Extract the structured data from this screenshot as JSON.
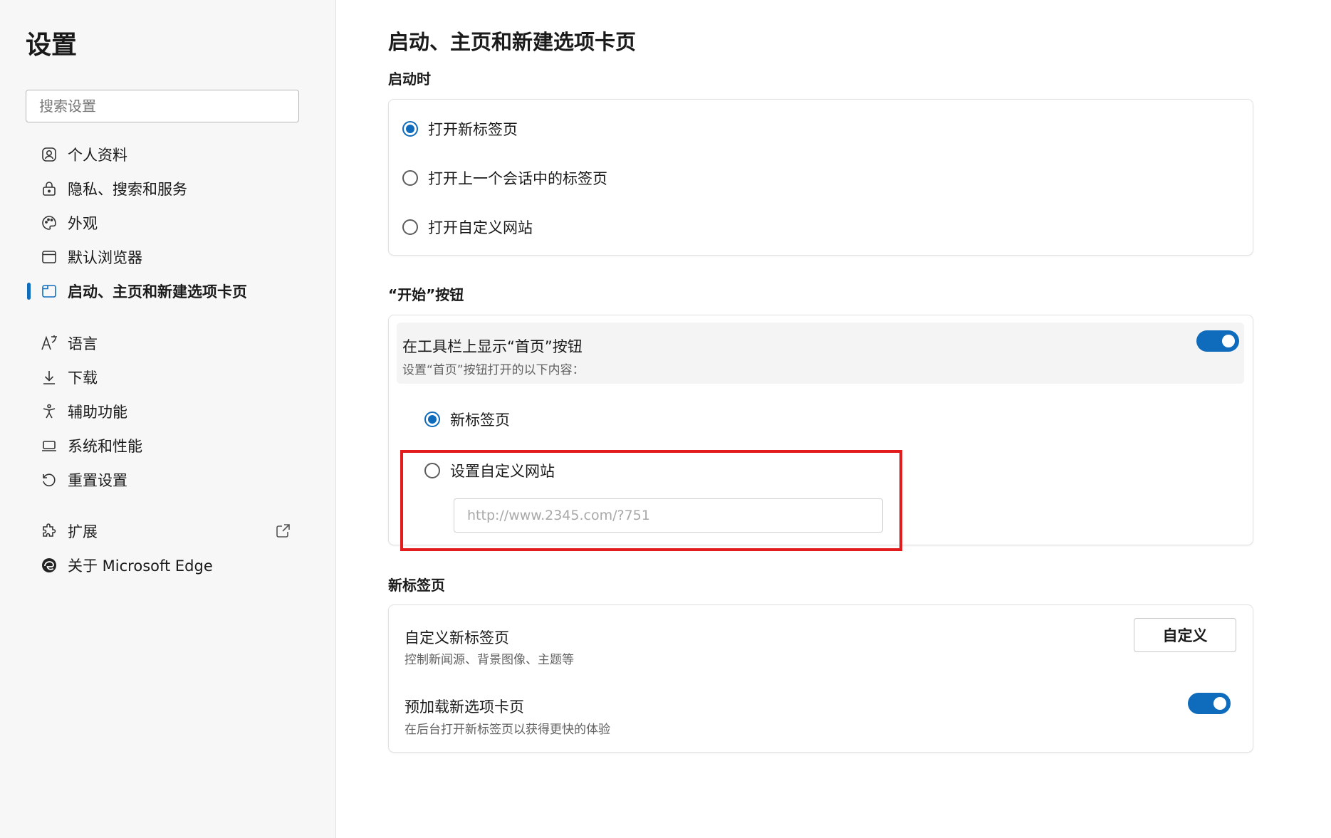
{
  "sidebar": {
    "title": "设置",
    "search_placeholder": "搜索设置",
    "items": [
      {
        "label": "个人资料",
        "icon": "profile-icon"
      },
      {
        "label": "隐私、搜索和服务",
        "icon": "lock-icon"
      },
      {
        "label": "外观",
        "icon": "palette-icon"
      },
      {
        "label": "默认浏览器",
        "icon": "browser-window-icon"
      },
      {
        "label": "启动、主页和新建选项卡页",
        "icon": "start-page-icon",
        "active": true
      },
      {
        "label": "语言",
        "icon": "language-icon"
      },
      {
        "label": "下载",
        "icon": "download-icon"
      },
      {
        "label": "辅助功能",
        "icon": "accessibility-icon"
      },
      {
        "label": "系统和性能",
        "icon": "laptop-icon"
      },
      {
        "label": "重置设置",
        "icon": "reset-icon"
      },
      {
        "label": "扩展",
        "icon": "extensions-icon",
        "external_icon": "external-link-icon"
      },
      {
        "label": "关于 Microsoft Edge",
        "icon": "edge-logo-icon"
      }
    ]
  },
  "main": {
    "page_title": "启动、主页和新建选项卡页",
    "startup": {
      "title": "启动时",
      "options": [
        {
          "label": "打开新标签页",
          "checked": true
        },
        {
          "label": "打开上一个会话中的标签页",
          "checked": false
        },
        {
          "label": "打开自定义网站",
          "checked": false
        }
      ]
    },
    "home_button": {
      "title": "“开始”按钮",
      "toggle_title": "在工具栏上显示“首页”按钮",
      "toggle_subtitle": "设置“首页”按钮打开的以下内容：",
      "toggle_on": true,
      "options": [
        {
          "label": "新标签页",
          "checked": true
        },
        {
          "label": "设置自定义网站",
          "checked": false
        }
      ],
      "url_placeholder": "http://www.2345.com/?751"
    },
    "new_tab": {
      "title": "新标签页",
      "customize_title": "自定义新标签页",
      "customize_subtitle": "控制新闻源、背景图像、主题等",
      "customize_button": "自定义",
      "preload_title": "预加载新选项卡页",
      "preload_subtitle": "在后台打开新标签页以获得更快的体验",
      "preload_on": true
    }
  },
  "colors": {
    "accent": "#0f6cbd",
    "highlight": "#e21c1c"
  }
}
